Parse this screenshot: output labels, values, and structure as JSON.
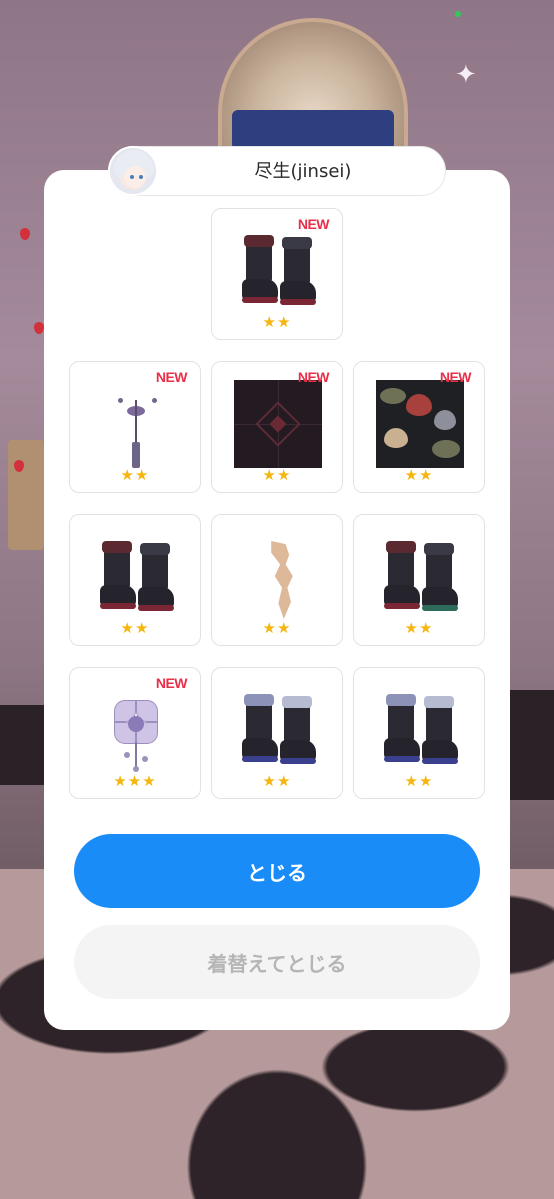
{
  "user": {
    "name": "尽生(jinsei)"
  },
  "items": [
    {
      "id": "boots-red-trim",
      "new": true,
      "stars": "★★"
    },
    {
      "id": "pendant",
      "new": true,
      "stars": "★★"
    },
    {
      "id": "dark-pattern-tile",
      "new": true,
      "stars": "★★"
    },
    {
      "id": "lotus-pattern-tile",
      "new": true,
      "stars": "★★"
    },
    {
      "id": "boots-red-trim-2",
      "new": false,
      "stars": "★★"
    },
    {
      "id": "skin-swatch",
      "new": false,
      "stars": "★★"
    },
    {
      "id": "boots-green-trim",
      "new": false,
      "stars": "★★"
    },
    {
      "id": "lavender-brooch",
      "new": true,
      "stars": "★★★"
    },
    {
      "id": "boots-blue-trim",
      "new": false,
      "stars": "★★"
    },
    {
      "id": "boots-blue-trim-2",
      "new": false,
      "stars": "★★"
    }
  ],
  "labels": {
    "new": "NEW"
  },
  "buttons": {
    "close": "とじる",
    "change_and_close": "着替えてとじる"
  },
  "colors": {
    "accent": "#1a8cf8",
    "new_badge": "#e8304a",
    "star": "#f4b60f",
    "disabled_text": "#b5b5b5"
  }
}
